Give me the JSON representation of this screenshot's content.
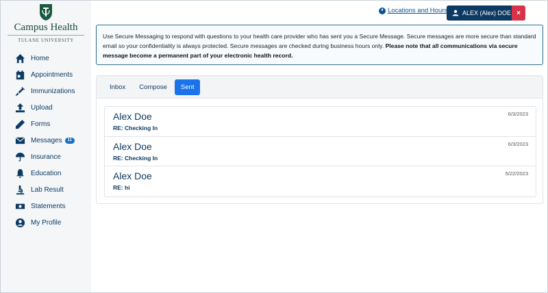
{
  "sidebar": {
    "logo_title": "Campus Health",
    "logo_subtitle": "TULANE UNIVERSITY",
    "items": [
      {
        "label": "Home",
        "icon": "home-icon"
      },
      {
        "label": "Appointments",
        "icon": "calendar-icon"
      },
      {
        "label": "Immunizations",
        "icon": "syringe-icon"
      },
      {
        "label": "Upload",
        "icon": "upload-icon"
      },
      {
        "label": "Forms",
        "icon": "pencil-icon"
      },
      {
        "label": "Messages",
        "icon": "envelope-icon",
        "badge": "11"
      },
      {
        "label": "Insurance",
        "icon": "umbrella-icon"
      },
      {
        "label": "Education",
        "icon": "bell-icon"
      },
      {
        "label": "Lab Result",
        "icon": "microscope-icon"
      },
      {
        "label": "Statements",
        "icon": "money-icon"
      },
      {
        "label": "My Profile",
        "icon": "user-circle-icon"
      }
    ]
  },
  "header": {
    "locations_link": "Locations and Hours",
    "user_label": "ALEX (Alex) DOE",
    "close_label": "×"
  },
  "info": {
    "text": "Use Secure Messaging to respond with questions to your health care provider who has sent you a Secure Message. Secure messages are more secure than standard email so your confidentiality is always protected. Secure messages are checked during business hours only. ",
    "bold": "Please note that all communications via secure message become a permanent part of your electronic health record."
  },
  "tabs": [
    {
      "label": "Inbox",
      "active": false
    },
    {
      "label": "Compose",
      "active": false
    },
    {
      "label": "Sent",
      "active": true
    }
  ],
  "messages": [
    {
      "sender": "Alex Doe",
      "subject": "RE: Checking In",
      "date": "6/3/2023"
    },
    {
      "sender": "Alex Doe",
      "subject": "RE: Checking In",
      "date": "6/3/2023"
    },
    {
      "sender": "Alex Doe",
      "subject": "RE: hi",
      "date": "5/22/2023"
    }
  ],
  "colors": {
    "brand_navy": "#0d3a63",
    "accent_blue": "#1a73e8",
    "close_red": "#d9334a",
    "logo_green": "#1a4a3a"
  }
}
